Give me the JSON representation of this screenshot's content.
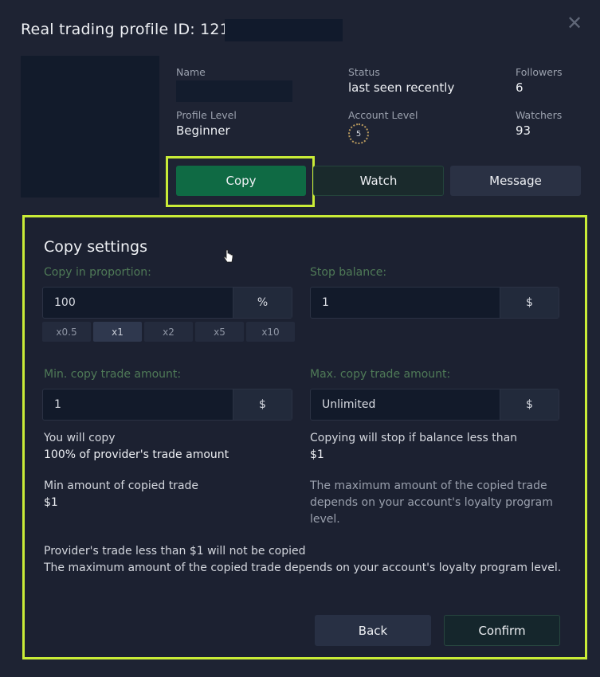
{
  "window": {
    "title": "Real trading profile ID: 1219",
    "close_icon": "close-icon"
  },
  "profile": {
    "name_label": "Name",
    "status_label": "Status",
    "status_value": "last seen recently",
    "followers_label": "Followers",
    "followers_value": "6",
    "profile_level_label": "Profile Level",
    "profile_level_value": "Beginner",
    "account_level_label": "Account Level",
    "account_level_value": "5",
    "watchers_label": "Watchers",
    "watchers_value": "93"
  },
  "actions": {
    "copy": "Copy",
    "watch": "Watch",
    "message": "Message"
  },
  "settings": {
    "title": "Copy settings",
    "proportion_label": "Copy in proportion:",
    "proportion_value": "100",
    "proportion_unit": "%",
    "multipliers": [
      "x0.5",
      "x1",
      "x2",
      "x5",
      "x10"
    ],
    "stop_balance_label": "Stop balance:",
    "stop_balance_value": "1",
    "stop_balance_unit": "$",
    "min_label": "Min. copy trade amount:",
    "min_value": "1",
    "min_unit": "$",
    "max_label": "Max. copy trade amount:",
    "max_value": "Unlimited",
    "max_unit": "$",
    "you_will_copy": "You will copy",
    "copy_percent": "100% of provider's trade amount",
    "stop_info": "Copying will stop if balance less than",
    "stop_info_value": "$1",
    "min_amount_label": "Min amount of copied trade",
    "min_amount_value": "$1",
    "max_info": "The maximum amount of the copied trade depends on your account's loyalty program level.",
    "notice_1": "Provider's trade less than $1 will not be copied",
    "notice_2": "The maximum amount of the copied trade depends on your account's loyalty program level.",
    "back": "Back",
    "confirm": "Confirm"
  },
  "colors": {
    "accent_highlight": "#c9ec37",
    "copy_button": "#0f6a44",
    "background": "#1e2333"
  }
}
